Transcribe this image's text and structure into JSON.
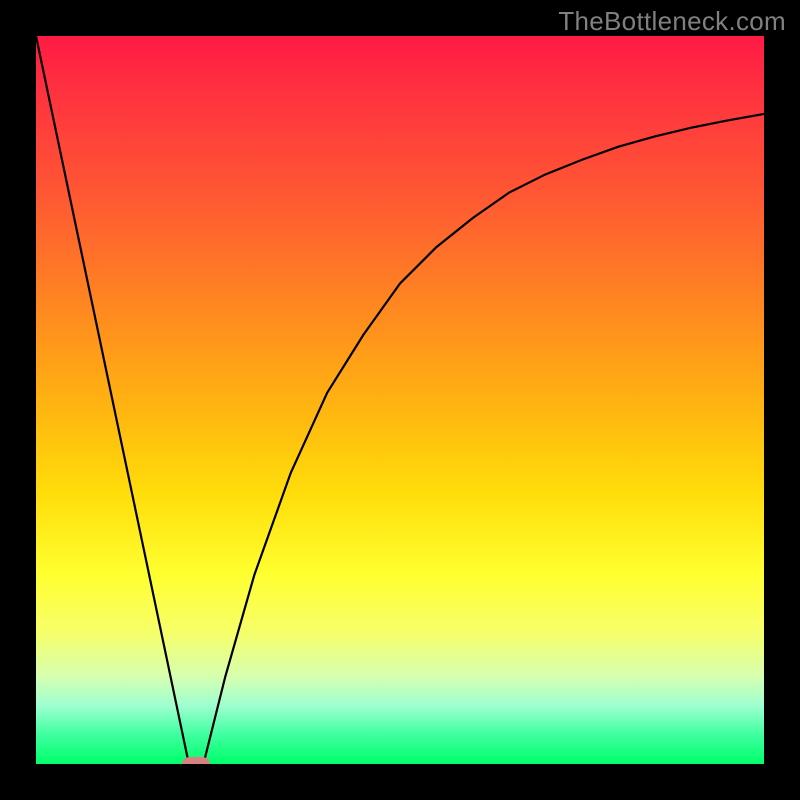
{
  "watermark": "TheBottleneck.com",
  "chart_data": {
    "type": "line",
    "title": "",
    "xlabel": "",
    "ylabel": "",
    "xlim": [
      0,
      100
    ],
    "ylim": [
      0,
      100
    ],
    "grid": false,
    "series": [
      {
        "name": "left-branch",
        "x": [
          0,
          21
        ],
        "y": [
          100,
          0
        ]
      },
      {
        "name": "right-branch",
        "x": [
          23,
          26,
          30,
          35,
          40,
          45,
          50,
          55,
          60,
          65,
          70,
          75,
          80,
          85,
          90,
          95,
          100
        ],
        "y": [
          0,
          12,
          26,
          40,
          51,
          59,
          66,
          71,
          75,
          78.5,
          81,
          83,
          84.8,
          86.2,
          87.4,
          88.4,
          89.3
        ]
      }
    ],
    "marker": {
      "x": 22,
      "y": 0
    },
    "background_gradient": {
      "top": "#ff1a44",
      "bottom": "#00ff6a"
    }
  }
}
